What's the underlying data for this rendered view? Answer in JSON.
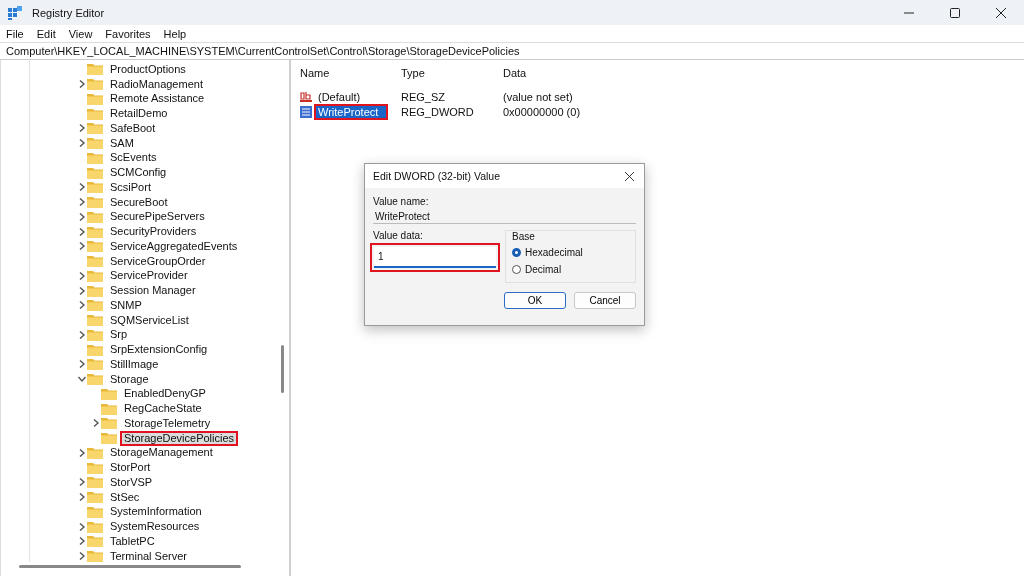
{
  "window": {
    "title": "Registry Editor"
  },
  "menu": [
    "File",
    "Edit",
    "View",
    "Favorites",
    "Help"
  ],
  "address": "Computer\\HKEY_LOCAL_MACHINE\\SYSTEM\\CurrentControlSet\\Control\\Storage\\StorageDevicePolicies",
  "tree": [
    {
      "label": "ProductOptions",
      "expandable": false,
      "selected": false,
      "highlighted": false
    },
    {
      "label": "RadioManagement",
      "expandable": true,
      "expanded": false,
      "selected": false,
      "highlighted": false
    },
    {
      "label": "Remote Assistance",
      "expandable": false,
      "selected": false,
      "highlighted": false
    },
    {
      "label": "RetailDemo",
      "expandable": false,
      "selected": false,
      "highlighted": false
    },
    {
      "label": "SafeBoot",
      "expandable": true,
      "expanded": false,
      "selected": false,
      "highlighted": false
    },
    {
      "label": "SAM",
      "expandable": true,
      "expanded": false,
      "selected": false,
      "highlighted": false
    },
    {
      "label": "ScEvents",
      "expandable": false,
      "selected": false,
      "highlighted": false
    },
    {
      "label": "SCMConfig",
      "expandable": false,
      "selected": false,
      "highlighted": false
    },
    {
      "label": "ScsiPort",
      "expandable": true,
      "expanded": false,
      "selected": false,
      "highlighted": false
    },
    {
      "label": "SecureBoot",
      "expandable": true,
      "expanded": false,
      "selected": false,
      "highlighted": false
    },
    {
      "label": "SecurePipeServers",
      "expandable": true,
      "expanded": false,
      "selected": false,
      "highlighted": false
    },
    {
      "label": "SecurityProviders",
      "expandable": true,
      "expanded": false,
      "selected": false,
      "highlighted": false
    },
    {
      "label": "ServiceAggregatedEvents",
      "expandable": true,
      "expanded": false,
      "selected": false,
      "highlighted": false
    },
    {
      "label": "ServiceGroupOrder",
      "expandable": false,
      "selected": false,
      "highlighted": false
    },
    {
      "label": "ServiceProvider",
      "expandable": true,
      "expanded": false,
      "selected": false,
      "highlighted": false
    },
    {
      "label": "Session Manager",
      "expandable": true,
      "expanded": false,
      "selected": false,
      "highlighted": false
    },
    {
      "label": "SNMP",
      "expandable": true,
      "expanded": false,
      "selected": false,
      "highlighted": false
    },
    {
      "label": "SQMServiceList",
      "expandable": false,
      "selected": false,
      "highlighted": false
    },
    {
      "label": "Srp",
      "expandable": true,
      "expanded": false,
      "selected": false,
      "highlighted": false
    },
    {
      "label": "SrpExtensionConfig",
      "expandable": false,
      "selected": false,
      "highlighted": false
    },
    {
      "label": "StillImage",
      "expandable": true,
      "expanded": false,
      "selected": false,
      "highlighted": false
    },
    {
      "label": "Storage",
      "expandable": true,
      "expanded": true,
      "selected": false,
      "highlighted": false,
      "children": [
        {
          "label": "EnabledDenyGP",
          "expandable": false,
          "selected": false,
          "highlighted": false
        },
        {
          "label": "RegCacheState",
          "expandable": false,
          "selected": false,
          "highlighted": false
        },
        {
          "label": "StorageTelemetry",
          "expandable": true,
          "expanded": false,
          "selected": false,
          "highlighted": false
        },
        {
          "label": "StorageDevicePolicies",
          "expandable": false,
          "selected": true,
          "highlighted": true
        }
      ]
    },
    {
      "label": "StorageManagement",
      "expandable": true,
      "expanded": false,
      "selected": false,
      "highlighted": false
    },
    {
      "label": "StorPort",
      "expandable": false,
      "selected": false,
      "highlighted": false
    },
    {
      "label": "StorVSP",
      "expandable": true,
      "expanded": false,
      "selected": false,
      "highlighted": false
    },
    {
      "label": "StSec",
      "expandable": true,
      "expanded": false,
      "selected": false,
      "highlighted": false
    },
    {
      "label": "SystemInformation",
      "expandable": false,
      "selected": false,
      "highlighted": false
    },
    {
      "label": "SystemResources",
      "expandable": true,
      "expanded": false,
      "selected": false,
      "highlighted": false
    },
    {
      "label": "TabletPC",
      "expandable": true,
      "expanded": false,
      "selected": false,
      "highlighted": false
    },
    {
      "label": "Terminal Server",
      "expandable": true,
      "expanded": false,
      "selected": false,
      "highlighted": false
    }
  ],
  "values": {
    "columns": [
      "Name",
      "Type",
      "Data"
    ],
    "rows": [
      {
        "kind": "string",
        "name": "(Default)",
        "type": "REG_SZ",
        "data": "(value not set)",
        "selected": false,
        "highlighted": false
      },
      {
        "kind": "dword",
        "name": "WriteProtect",
        "type": "REG_DWORD",
        "data": "0x00000000 (0)",
        "selected": true,
        "highlighted": true
      }
    ]
  },
  "dialog": {
    "title": "Edit DWORD (32-bit) Value",
    "value_name_label": "Value name:",
    "value_name": "WriteProtect",
    "value_data_label": "Value data:",
    "value_data": "1",
    "value_data_highlighted": true,
    "base_label": "Base",
    "radios": [
      {
        "label": "Hexadecimal",
        "selected": true
      },
      {
        "label": "Decimal",
        "selected": false
      }
    ],
    "buttons": [
      {
        "label": "OK",
        "default": true
      },
      {
        "label": "Cancel",
        "default": false
      }
    ]
  }
}
